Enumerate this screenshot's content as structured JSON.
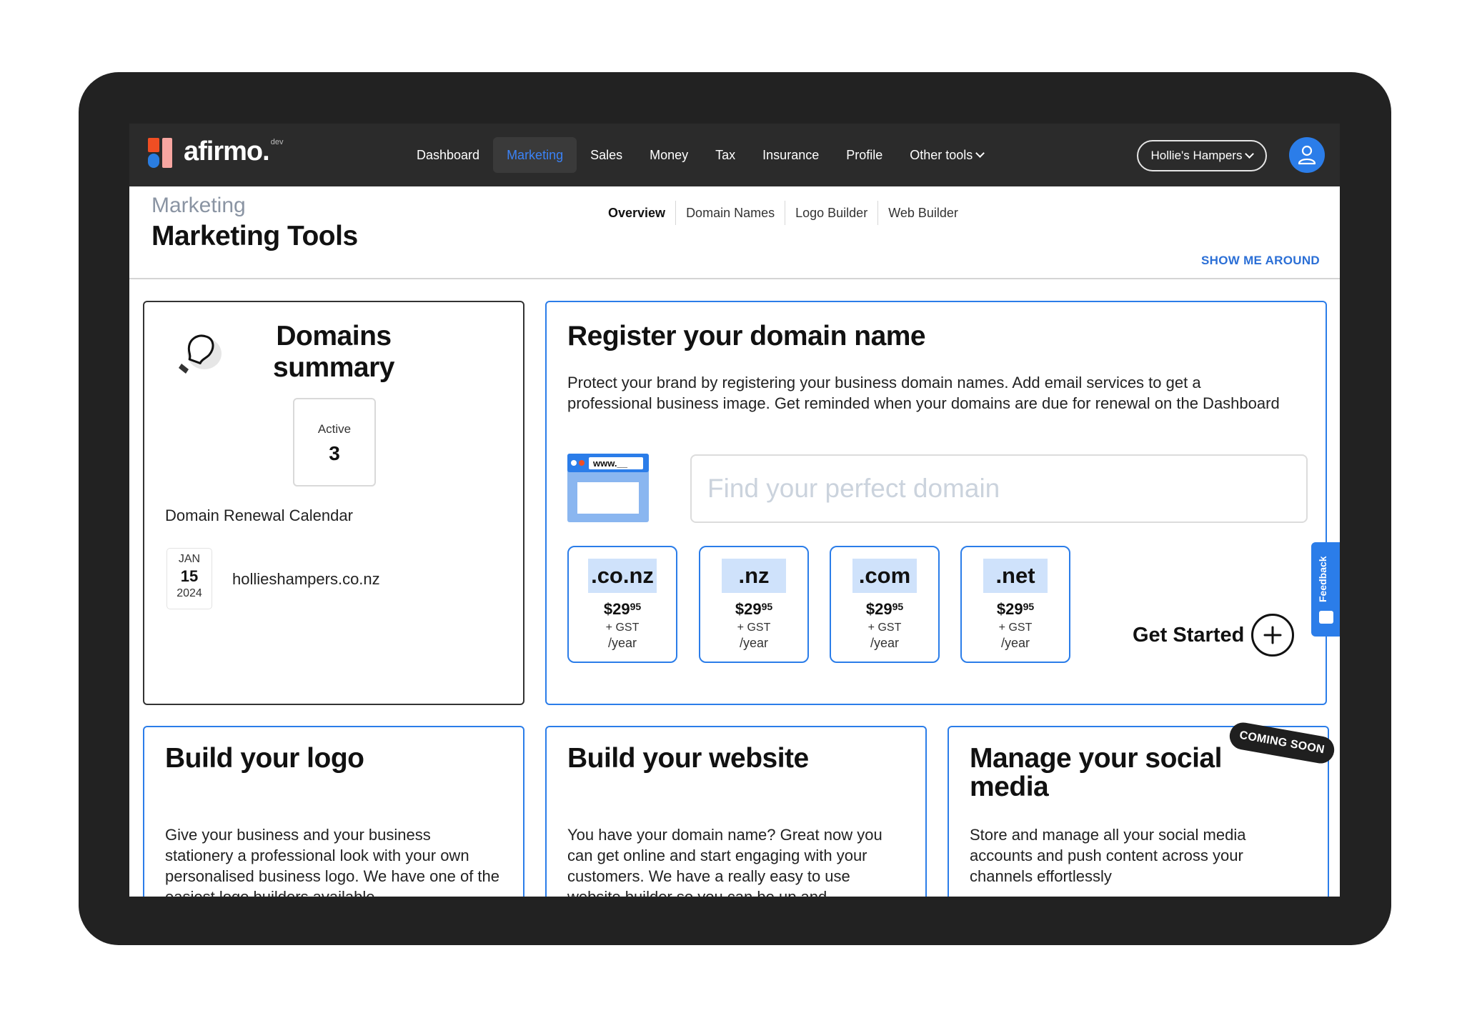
{
  "brand": {
    "name": "afirmo.",
    "tag": "dev"
  },
  "nav": {
    "items": [
      {
        "label": "Dashboard"
      },
      {
        "label": "Marketing"
      },
      {
        "label": "Sales"
      },
      {
        "label": "Money"
      },
      {
        "label": "Tax"
      },
      {
        "label": "Insurance"
      },
      {
        "label": "Profile"
      },
      {
        "label": "Other tools"
      }
    ],
    "active": "Marketing",
    "business": "Hollie's Hampers"
  },
  "header": {
    "breadcrumb": "Marketing",
    "title": "Marketing Tools",
    "tabs": [
      {
        "label": "Overview"
      },
      {
        "label": "Domain Names"
      },
      {
        "label": "Logo Builder"
      },
      {
        "label": "Web Builder"
      }
    ],
    "show_me_around": "SHOW ME AROUND"
  },
  "domains_summary": {
    "title": "Domains summary",
    "active_label": "Active",
    "active_count": "3",
    "calendar_title": "Domain Renewal Calendar",
    "renewals": [
      {
        "month": "JAN",
        "day": "15",
        "year": "2024",
        "domain": "hollieshampers.co.nz"
      }
    ]
  },
  "register": {
    "title": "Register your domain name",
    "description": "Protect your brand by registering your business domain names. Add email services to get a professional business image. Get reminded when your domains are due for renewal on the Dashboard",
    "browser_label": "www.__",
    "search_placeholder": "Find your perfect domain",
    "tlds": [
      {
        "name": ".co.nz",
        "price": "$29",
        "cents": "95",
        "gst": "+ GST",
        "period": "/year"
      },
      {
        "name": ".nz",
        "price": "$29",
        "cents": "95",
        "gst": "+ GST",
        "period": "/year"
      },
      {
        "name": ".com",
        "price": "$29",
        "cents": "95",
        "gst": "+ GST",
        "period": "/year"
      },
      {
        "name": ".net",
        "price": "$29",
        "cents": "95",
        "gst": "+ GST",
        "period": "/year"
      }
    ],
    "cta": "Get Started"
  },
  "feedback": "Feedback",
  "cards": {
    "logo": {
      "title": "Build your logo",
      "text": "Give your business and your business stationery a professional look with your own personalised business logo. We have one of the easiest logo builders available"
    },
    "website": {
      "title": "Build your website",
      "text": "You have your domain name? Great now you can get online and start engaging with your customers. We have a really easy to use website builder so you can be up and"
    },
    "social": {
      "title": "Manage your social media",
      "text": "Store and manage all your social media accounts and push content across your channels effortlessly",
      "badge": "COMING SOON"
    }
  },
  "colors": {
    "accent": "#2b7de9",
    "nav_bg": "#2b2b2b",
    "frame": "#222222"
  }
}
